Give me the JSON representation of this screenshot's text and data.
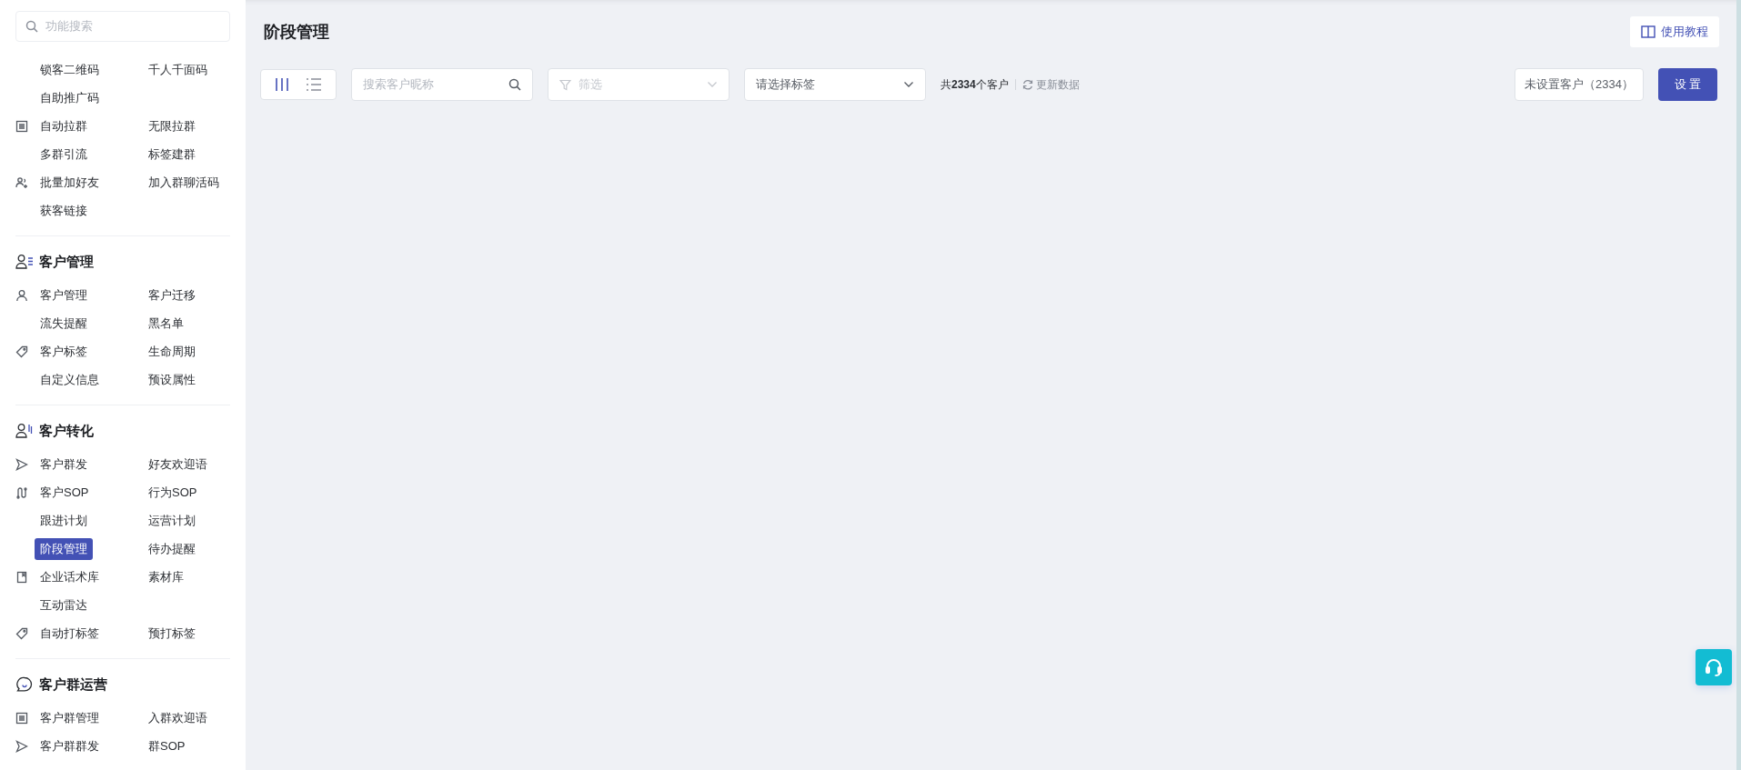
{
  "sidebar": {
    "search": {
      "placeholder": "功能搜索"
    },
    "groups": [
      {
        "rows": [
          {
            "items": [
              {
                "label": "锁客二维码",
                "selected": false
              },
              {
                "label": "千人千面码",
                "selected": false
              }
            ]
          },
          {
            "items": [
              {
                "label": "自助推广码",
                "selected": false
              }
            ]
          },
          {
            "items": [
              {
                "label": "自动拉群",
                "selected": false
              },
              {
                "label": "无限拉群",
                "selected": false
              }
            ]
          },
          {
            "items": [
              {
                "label": "多群引流",
                "selected": false
              },
              {
                "label": "标签建群",
                "selected": false
              }
            ]
          },
          {
            "items": [
              {
                "label": "批量加好友",
                "selected": false
              },
              {
                "label": "加入群聊活码",
                "selected": false
              }
            ]
          },
          {
            "items": [
              {
                "label": "获客链接",
                "selected": false
              }
            ]
          }
        ]
      },
      {
        "title": "客户管理",
        "rows": [
          {
            "items": [
              {
                "label": "客户管理",
                "selected": false
              },
              {
                "label": "客户迁移",
                "selected": false
              }
            ]
          },
          {
            "items": [
              {
                "label": "流失提醒",
                "selected": false
              },
              {
                "label": "黑名单",
                "selected": false
              }
            ]
          },
          {
            "items": [
              {
                "label": "客户标签",
                "selected": false
              },
              {
                "label": "生命周期",
                "selected": false
              }
            ]
          },
          {
            "items": [
              {
                "label": "自定义信息",
                "selected": false
              },
              {
                "label": "预设属性",
                "selected": false
              }
            ]
          }
        ]
      },
      {
        "title": "客户转化",
        "rows": [
          {
            "items": [
              {
                "label": "客户群发",
                "selected": false
              },
              {
                "label": "好友欢迎语",
                "selected": false
              }
            ]
          },
          {
            "items": [
              {
                "label": "客户SOP",
                "selected": false
              },
              {
                "label": "行为SOP",
                "selected": false
              }
            ]
          },
          {
            "items": [
              {
                "label": "跟进计划",
                "selected": false
              },
              {
                "label": "运营计划",
                "selected": false
              }
            ]
          },
          {
            "items": [
              {
                "label": "阶段管理",
                "selected": true
              },
              {
                "label": "待办提醒",
                "selected": false
              }
            ]
          },
          {
            "items": [
              {
                "label": "企业话术库",
                "selected": false
              },
              {
                "label": "素材库",
                "selected": false
              }
            ]
          },
          {
            "items": [
              {
                "label": "互动雷达",
                "selected": false
              }
            ]
          },
          {
            "items": [
              {
                "label": "自动打标签",
                "selected": false
              },
              {
                "label": "预打标签",
                "selected": false
              }
            ]
          }
        ]
      },
      {
        "title": "客户群运营",
        "rows": [
          {
            "items": [
              {
                "label": "客户群管理",
                "selected": false
              },
              {
                "label": "入群欢迎语",
                "selected": false
              }
            ]
          },
          {
            "items": [
              {
                "label": "客户群群发",
                "selected": false
              },
              {
                "label": "群SOP",
                "selected": false
              }
            ]
          }
        ]
      }
    ]
  },
  "page": {
    "title": "阶段管理",
    "tutorial_button": "使用教程"
  },
  "toolbar": {
    "view_toggle": [
      {
        "selected": true
      },
      {
        "selected": false
      }
    ],
    "search": {
      "placeholder": "搜索客户昵称"
    },
    "filter": {
      "placeholder": "筛选",
      "disabled": true
    },
    "tag_select": {
      "placeholder": "请选择标签"
    },
    "count": "共**2334**个客户",
    "refresh": "更新数据",
    "unset_button": "未设置客户（2334）",
    "settings_button": "设 置"
  }
}
